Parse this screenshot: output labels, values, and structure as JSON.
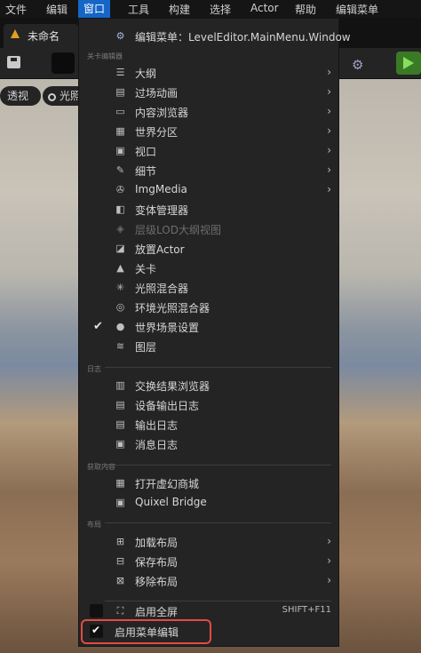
{
  "menubar": {
    "items": [
      {
        "label": "文件"
      },
      {
        "label": "编辑"
      },
      {
        "label": "窗口"
      },
      {
        "label": "工具"
      },
      {
        "label": "构建"
      },
      {
        "label": "选择"
      },
      {
        "label": "Actor"
      },
      {
        "label": "帮助"
      },
      {
        "label": "编辑菜单"
      }
    ],
    "active_index": 2
  },
  "tab": {
    "label": "未命名",
    "icon": "level-icon"
  },
  "viewport": {
    "perspective_label": "透视",
    "lighting_label": "光照"
  },
  "menu": {
    "header": "编辑菜单：LevelEditor.MainMenu.Window",
    "sections": {
      "level_editor": "关卡编辑器",
      "log": "日志",
      "get_content": "获取内容",
      "layout": "布局"
    },
    "items": {
      "outline": "大纲",
      "cinematics": "过场动画",
      "content_browser": "内容浏览器",
      "world_partition": "世界分区",
      "viewports": "视口",
      "details": "细节",
      "imgmedia": "ImgMedia",
      "variant_manager": "变体管理器",
      "hlod_outliner": "层级LOD大纲视图",
      "place_actors": "放置Actor",
      "levels": "关卡",
      "light_mixer": "光照混合器",
      "env_light_mixer": "环境光照混合器",
      "world_settings": "世界场景设置",
      "layers": "图层",
      "interchange_browser": "交换结果浏览器",
      "device_output_log": "设备输出日志",
      "output_log": "输出日志",
      "message_log": "消息日志",
      "open_marketplace": "打开虚幻商城",
      "quixel_bridge": "Quixel Bridge",
      "load_layout": "加载布局",
      "save_layout": "保存布局",
      "remove_layout": "移除布局",
      "fullscreen": "启用全屏",
      "enable_menu_edit": "启用菜单编辑"
    },
    "fullscreen_shortcut": "SHIFT+F11",
    "fullscreen_checked": false,
    "menu_edit_checked": true,
    "world_settings_checked": true
  },
  "colors": {
    "accent": "#1566c7",
    "highlight": "#e24b43"
  }
}
